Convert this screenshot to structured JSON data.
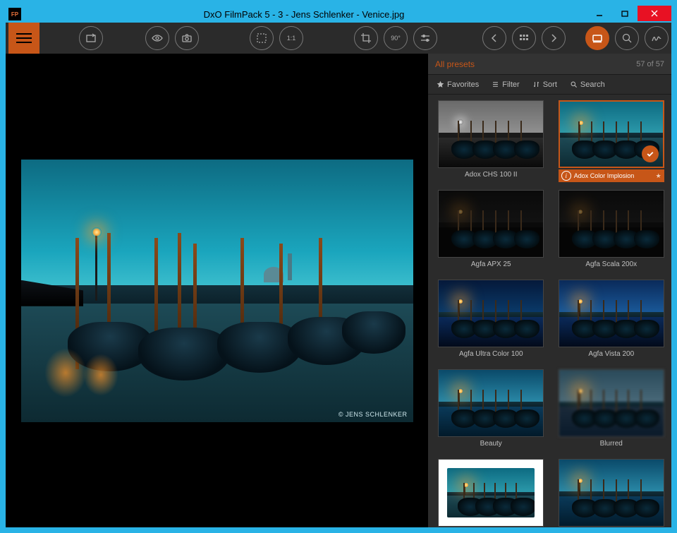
{
  "app_logo_text": "FP",
  "title": "DxO FilmPack 5 - 3 - Jens Schlenker - Venice.jpg",
  "watermark": "© JENS SCHLENKER",
  "toolbar": {
    "ratio_label": "1:1",
    "rotate_label": "90°"
  },
  "panel": {
    "title": "All presets",
    "count": "57 of 57",
    "filters": {
      "favorites": "Favorites",
      "filter": "Filter",
      "sort": "Sort",
      "search": "Search"
    }
  },
  "presets": [
    {
      "name": "Adox CHS 100 II",
      "variant": "bw",
      "selected": false
    },
    {
      "name": "Adox Color Implosion",
      "variant": "color",
      "selected": true
    },
    {
      "name": "Agfa APX 25",
      "variant": "dark",
      "selected": false
    },
    {
      "name": "Agfa Scala 200x",
      "variant": "dark",
      "selected": false
    },
    {
      "name": "Agfa Ultra Color 100",
      "variant": "blue",
      "selected": false
    },
    {
      "name": "Agfa Vista 200",
      "variant": "vista",
      "selected": false
    },
    {
      "name": "Beauty",
      "variant": "beauty",
      "selected": false
    },
    {
      "name": "Blurred",
      "variant": "blur",
      "selected": false
    },
    {
      "name": "",
      "variant": "white",
      "selected": false
    },
    {
      "name": "",
      "variant": "beauty",
      "selected": false
    }
  ]
}
